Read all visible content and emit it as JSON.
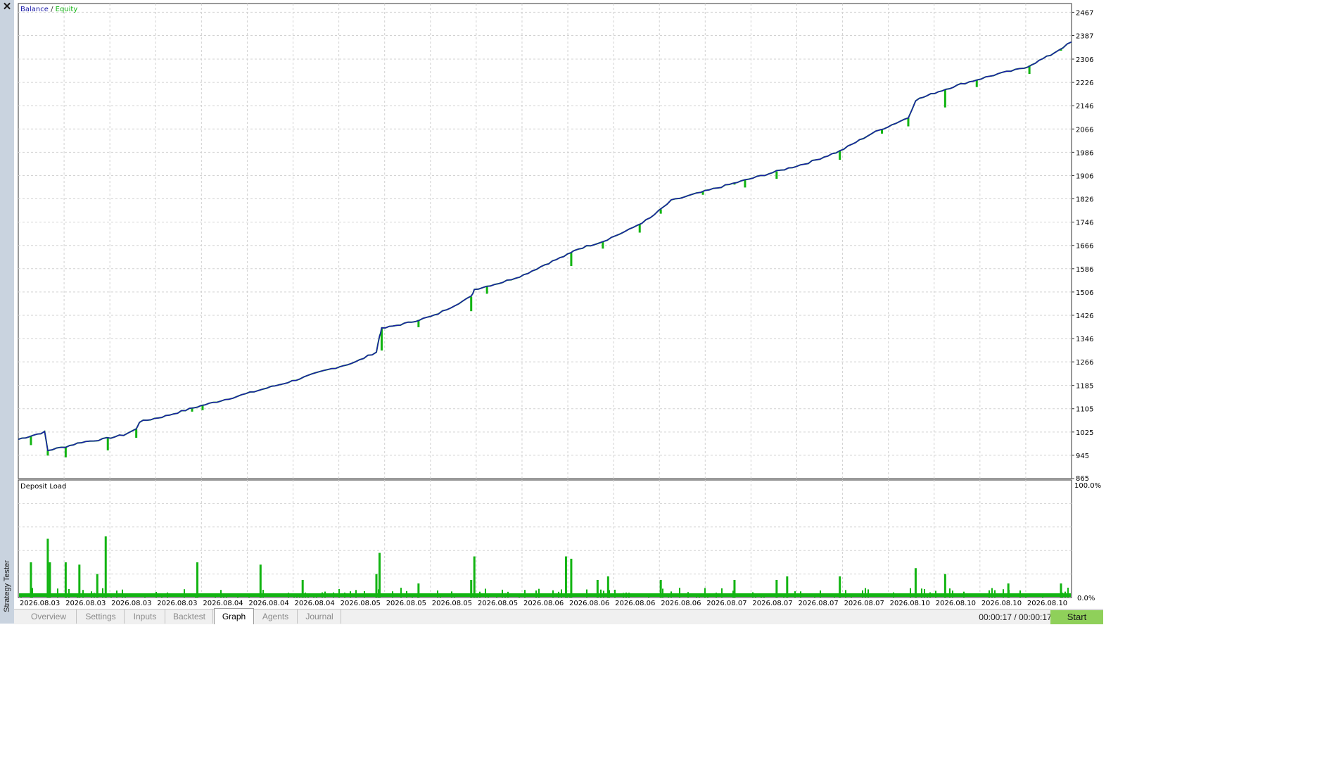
{
  "side_panel": {
    "close_glyph": "✕",
    "title": "Strategy Tester"
  },
  "chart_data": [
    {
      "type": "line",
      "legend": {
        "items": [
          "Balance",
          "Equity"
        ],
        "separator": "/",
        "placement": "top-left"
      },
      "colors": {
        "balance": "#1c1ca8",
        "equity": "#12b412",
        "grid": "#d2d2d2"
      },
      "y_ticks": [
        2467,
        2387,
        2306,
        2226,
        2146,
        2066,
        1986,
        1906,
        1826,
        1746,
        1666,
        1586,
        1506,
        1426,
        1346,
        1266,
        1185,
        1105,
        1025,
        945,
        865
      ],
      "ylim": [
        865,
        2497
      ],
      "grid": true,
      "x_range": [
        0,
        1
      ],
      "balance": [
        [
          0.0,
          1000
        ],
        [
          0.025,
          1025
        ],
        [
          0.028,
          962
        ],
        [
          0.045,
          975
        ],
        [
          0.06,
          990
        ],
        [
          0.08,
          1000
        ],
        [
          0.1,
          1015
        ],
        [
          0.112,
          1035
        ],
        [
          0.115,
          1060
        ],
        [
          0.14,
          1080
        ],
        [
          0.17,
          1112
        ],
        [
          0.2,
          1140
        ],
        [
          0.22,
          1160
        ],
        [
          0.24,
          1180
        ],
        [
          0.26,
          1200
        ],
        [
          0.29,
          1235
        ],
        [
          0.32,
          1265
        ],
        [
          0.34,
          1300
        ],
        [
          0.343,
          1355
        ],
        [
          0.345,
          1380
        ],
        [
          0.37,
          1400
        ],
        [
          0.395,
          1425
        ],
        [
          0.43,
          1490
        ],
        [
          0.433,
          1515
        ],
        [
          0.46,
          1540
        ],
        [
          0.48,
          1565
        ],
        [
          0.5,
          1600
        ],
        [
          0.525,
          1640
        ],
        [
          0.528,
          1650
        ],
        [
          0.555,
          1680
        ],
        [
          0.58,
          1720
        ],
        [
          0.6,
          1760
        ],
        [
          0.62,
          1820
        ],
        [
          0.66,
          1860
        ],
        [
          0.69,
          1890
        ],
        [
          0.72,
          1920
        ],
        [
          0.75,
          1950
        ],
        [
          0.78,
          1990
        ],
        [
          0.81,
          2050
        ],
        [
          0.845,
          2105
        ],
        [
          0.852,
          2165
        ],
        [
          0.87,
          2190
        ],
        [
          0.895,
          2220
        ],
        [
          0.93,
          2255
        ],
        [
          0.955,
          2275
        ],
        [
          0.98,
          2320
        ],
        [
          1.0,
          2365
        ]
      ],
      "equity_dips": [
        [
          0.012,
          980
        ],
        [
          0.028,
          944
        ],
        [
          0.045,
          938
        ],
        [
          0.085,
          962
        ],
        [
          0.112,
          1005
        ],
        [
          0.165,
          1095
        ],
        [
          0.175,
          1100
        ],
        [
          0.23,
          1170
        ],
        [
          0.34,
          1300
        ],
        [
          0.345,
          1305
        ],
        [
          0.38,
          1385
        ],
        [
          0.43,
          1440
        ],
        [
          0.445,
          1500
        ],
        [
          0.525,
          1595
        ],
        [
          0.555,
          1655
        ],
        [
          0.59,
          1710
        ],
        [
          0.61,
          1775
        ],
        [
          0.65,
          1840
        ],
        [
          0.68,
          1875
        ],
        [
          0.69,
          1865
        ],
        [
          0.72,
          1895
        ],
        [
          0.78,
          1960
        ],
        [
          0.82,
          2050
        ],
        [
          0.845,
          2075
        ],
        [
          0.88,
          2140
        ],
        [
          0.91,
          2210
        ],
        [
          0.96,
          2255
        ],
        [
          0.99,
          2335
        ]
      ],
      "xlabels": [
        "2026.08.03",
        "2026.08.03",
        "2026.08.03",
        "2026.08.03",
        "2026.08.04",
        "2026.08.04",
        "2026.08.04",
        "2026.08.05",
        "2026.08.05",
        "2026.08.05",
        "2026.08.05",
        "2026.08.06",
        "2026.08.06",
        "2026.08.06",
        "2026.08.06",
        "2026.08.07",
        "2026.08.07",
        "2026.08.07",
        "2026.08.07",
        "2026.08.10",
        "2026.08.10",
        "2026.08.10",
        "2026.08.10"
      ]
    },
    {
      "type": "bar",
      "title": "Deposit Load",
      "ylim": [
        0,
        100
      ],
      "y_ticks_labels": [
        "100.0%",
        "0.0%"
      ],
      "color": "#12b412",
      "bars": [
        [
          0.012,
          30
        ],
        [
          0.028,
          50
        ],
        [
          0.03,
          30
        ],
        [
          0.045,
          30
        ],
        [
          0.058,
          28
        ],
        [
          0.075,
          20
        ],
        [
          0.083,
          52
        ],
        [
          0.17,
          30
        ],
        [
          0.23,
          28
        ],
        [
          0.27,
          15
        ],
        [
          0.34,
          20
        ],
        [
          0.343,
          38
        ],
        [
          0.38,
          12
        ],
        [
          0.43,
          15
        ],
        [
          0.433,
          35
        ],
        [
          0.52,
          35
        ],
        [
          0.525,
          33
        ],
        [
          0.55,
          15
        ],
        [
          0.56,
          18
        ],
        [
          0.61,
          15
        ],
        [
          0.68,
          15
        ],
        [
          0.72,
          15
        ],
        [
          0.73,
          18
        ],
        [
          0.78,
          18
        ],
        [
          0.852,
          25
        ],
        [
          0.88,
          20
        ],
        [
          0.94,
          12
        ],
        [
          0.99,
          12
        ]
      ]
    }
  ],
  "tabs": [
    "Overview",
    "Settings",
    "Inputs",
    "Backtest",
    "Graph",
    "Agents",
    "Journal"
  ],
  "active_tab": "Graph",
  "timer": "00:00:17 / 00:00:17",
  "start_label": "Start"
}
